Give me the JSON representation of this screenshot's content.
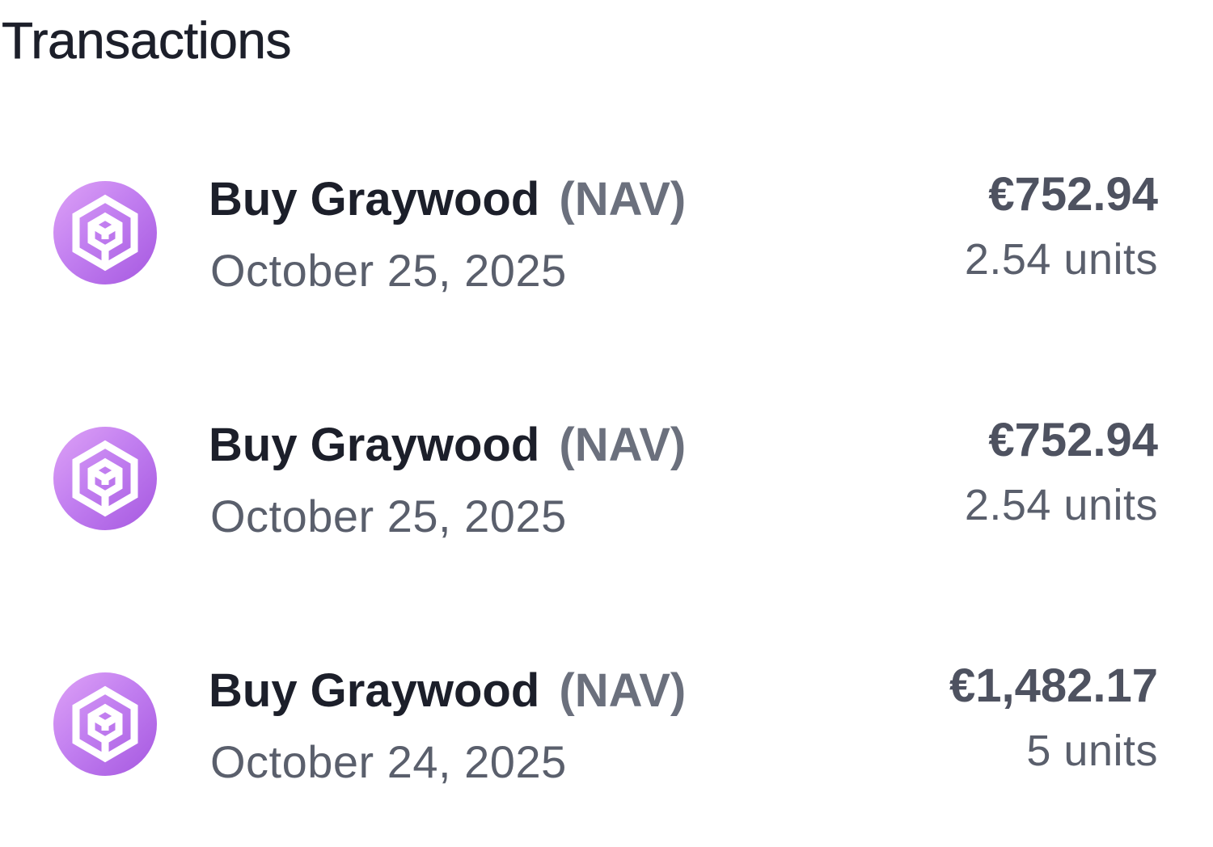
{
  "header": {
    "title": "Transactions"
  },
  "colors": {
    "logo_gradient_start": "#dea2f6",
    "logo_gradient_end": "#a658e0",
    "primary_text": "#1c1f2a",
    "secondary_text": "#5a5f6c",
    "ticker_text": "#6b707d",
    "amount_text": "#4e5260"
  },
  "transactions": [
    {
      "icon": "graywood-fund-logo-icon",
      "action": "Buy Graywood",
      "ticker": "(NAV)",
      "date": "October 25, 2025",
      "amount": "€752.94",
      "units": "2.54 units"
    },
    {
      "icon": "graywood-fund-logo-icon",
      "action": "Buy Graywood",
      "ticker": "(NAV)",
      "date": "October 25, 2025",
      "amount": "€752.94",
      "units": "2.54 units"
    },
    {
      "icon": "graywood-fund-logo-icon",
      "action": "Buy Graywood",
      "ticker": "(NAV)",
      "date": "October 24, 2025",
      "amount": "€1,482.17",
      "units": "5 units"
    }
  ]
}
